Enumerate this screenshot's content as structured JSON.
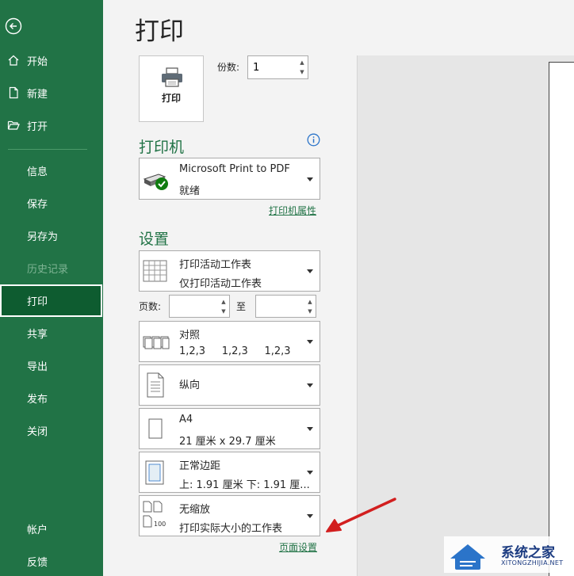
{
  "sidebar": {
    "items": [
      {
        "key": "home",
        "label": "开始",
        "icon": "home-icon"
      },
      {
        "key": "new",
        "label": "新建",
        "icon": "new-document-icon"
      },
      {
        "key": "open",
        "label": "打开",
        "icon": "folder-open-icon"
      },
      {
        "key": "info",
        "label": "信息"
      },
      {
        "key": "save",
        "label": "保存"
      },
      {
        "key": "saveas",
        "label": "另存为"
      },
      {
        "key": "history",
        "label": "历史记录",
        "disabled": true
      },
      {
        "key": "print",
        "label": "打印",
        "active": true
      },
      {
        "key": "share",
        "label": "共享"
      },
      {
        "key": "export",
        "label": "导出"
      },
      {
        "key": "publish",
        "label": "发布"
      },
      {
        "key": "close",
        "label": "关闭"
      },
      {
        "key": "account",
        "label": "帐户"
      },
      {
        "key": "feedback",
        "label": "反馈"
      }
    ]
  },
  "page": {
    "title": "打印"
  },
  "print_button": {
    "label": "打印"
  },
  "copies": {
    "label": "份数:",
    "value": "1"
  },
  "printer": {
    "heading": "打印机",
    "name": "Microsoft Print to PDF",
    "status": "就绪",
    "properties_link": "打印机属性"
  },
  "settings": {
    "heading": "设置",
    "scope": {
      "line1": "打印活动工作表",
      "line2": "仅打印活动工作表"
    },
    "pages_label": "页数:",
    "to_label": "至",
    "pages_from": "",
    "pages_to": "",
    "collate": {
      "line1": "对照",
      "line2": "1,2,3     1,2,3     1,2,3"
    },
    "orientation": {
      "line1": "纵向"
    },
    "paper": {
      "line1": "A4",
      "line2": "21 厘米 x 29.7 厘米"
    },
    "margins": {
      "line1": "正常边距",
      "line2": "上: 1.91 厘米 下: 1.91 厘..."
    },
    "scaling": {
      "line1": "无缩放",
      "line2": "打印实际大小的工作表"
    },
    "page_setup_link": "页面设置"
  },
  "watermark": {
    "text": "系统之家",
    "sub": "XITONGZHIJIA.NET"
  },
  "colors": {
    "accent": "#217346",
    "annotation_arrow": "#d21f1f"
  }
}
